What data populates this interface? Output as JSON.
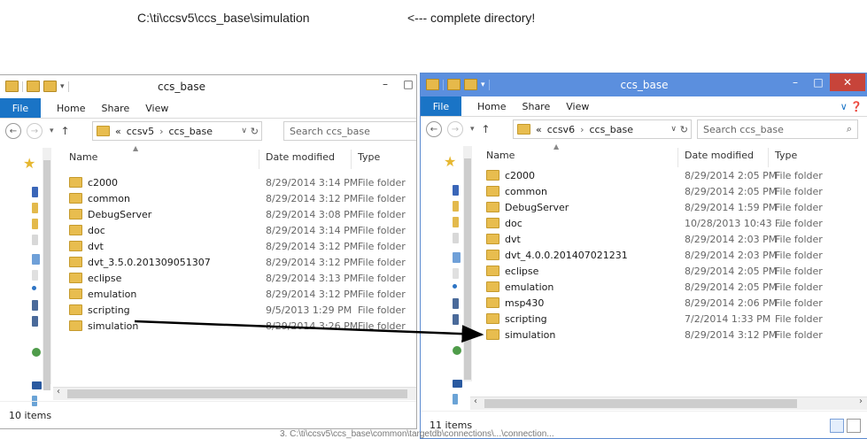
{
  "caption": {
    "path": "C:\\ti\\ccsv5\\ccs_base\\simulation",
    "note": "<--- complete directory!"
  },
  "bottom_note": "3. C:\\ti\\ccsv5\\ccs_base\\common\\targetdb\\connections\\...\\connection...",
  "icons": {
    "folder": "folder-icon",
    "quick_access": "star-icon",
    "up": "up-arrow-icon",
    "refresh": "refresh-icon",
    "search": "search-icon"
  },
  "colors": {
    "accent": "#1a74c6",
    "title_active": "#5b8fde",
    "close": "#c7443a",
    "folder": "#e8bd4f"
  },
  "left": {
    "title": "ccs_base",
    "ribbon": {
      "file": "File",
      "tabs": [
        "Home",
        "Share",
        "View"
      ]
    },
    "breadcrumb": [
      "«",
      "ccsv5",
      "›",
      "ccs_base"
    ],
    "search_placeholder": "Search ccs_base",
    "columns": {
      "name": "Name",
      "date": "Date modified",
      "type": "Type"
    },
    "rows": [
      {
        "name": "c2000",
        "date": "8/29/2014 3:14 PM",
        "type": "File folder"
      },
      {
        "name": "common",
        "date": "8/29/2014 3:12 PM",
        "type": "File folder"
      },
      {
        "name": "DebugServer",
        "date": "8/29/2014 3:08 PM",
        "type": "File folder"
      },
      {
        "name": "doc",
        "date": "8/29/2014 3:14 PM",
        "type": "File folder"
      },
      {
        "name": "dvt",
        "date": "8/29/2014 3:12 PM",
        "type": "File folder"
      },
      {
        "name": "dvt_3.5.0.201309051307",
        "date": "8/29/2014 3:12 PM",
        "type": "File folder"
      },
      {
        "name": "eclipse",
        "date": "8/29/2014 3:13 PM",
        "type": "File folder"
      },
      {
        "name": "emulation",
        "date": "8/29/2014 3:12 PM",
        "type": "File folder"
      },
      {
        "name": "scripting",
        "date": "9/5/2013 1:29 PM",
        "type": "File folder"
      },
      {
        "name": "simulation",
        "date": "8/29/2014 3:26 PM",
        "type": "File folder"
      }
    ],
    "status": "10 items"
  },
  "right": {
    "title": "ccs_base",
    "ribbon": {
      "file": "File",
      "tabs": [
        "Home",
        "Share",
        "View"
      ]
    },
    "breadcrumb": [
      "«",
      "ccsv6",
      "›",
      "ccs_base"
    ],
    "search_placeholder": "Search ccs_base",
    "columns": {
      "name": "Name",
      "date": "Date modified",
      "type": "Type"
    },
    "rows": [
      {
        "name": "c2000",
        "date": "8/29/2014 2:05 PM",
        "type": "File folder"
      },
      {
        "name": "common",
        "date": "8/29/2014 2:05 PM",
        "type": "File folder"
      },
      {
        "name": "DebugServer",
        "date": "8/29/2014 1:59 PM",
        "type": "File folder"
      },
      {
        "name": "doc",
        "date": "10/28/2013 10:43 ...",
        "type": "File folder"
      },
      {
        "name": "dvt",
        "date": "8/29/2014 2:03 PM",
        "type": "File folder"
      },
      {
        "name": "dvt_4.0.0.201407021231",
        "date": "8/29/2014 2:03 PM",
        "type": "File folder"
      },
      {
        "name": "eclipse",
        "date": "8/29/2014 2:05 PM",
        "type": "File folder"
      },
      {
        "name": "emulation",
        "date": "8/29/2014 2:05 PM",
        "type": "File folder"
      },
      {
        "name": "msp430",
        "date": "8/29/2014 2:06 PM",
        "type": "File folder"
      },
      {
        "name": "scripting",
        "date": "7/2/2014 1:33 PM",
        "type": "File folder"
      },
      {
        "name": "simulation",
        "date": "8/29/2014 3:12 PM",
        "type": "File folder"
      }
    ],
    "status": "11 items"
  }
}
